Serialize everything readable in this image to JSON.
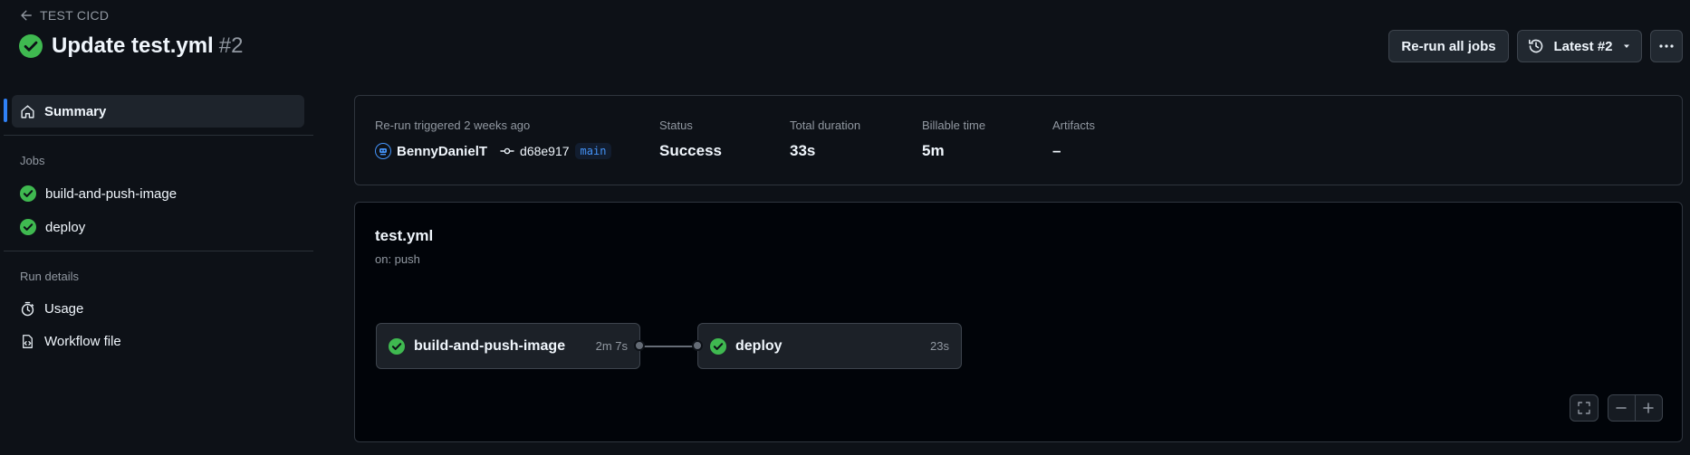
{
  "header": {
    "back_label": "TEST CICD",
    "title": "Update test.yml",
    "run_number": "#2",
    "rerun_label": "Re-run all jobs",
    "latest_label": "Latest #2"
  },
  "sidebar": {
    "summary_label": "Summary",
    "jobs_heading": "Jobs",
    "jobs": [
      {
        "label": "build-and-push-image"
      },
      {
        "label": "deploy"
      }
    ],
    "run_details_heading": "Run details",
    "usage_label": "Usage",
    "workflow_file_label": "Workflow file"
  },
  "summary": {
    "trigger_text": "Re-run triggered 2 weeks ago",
    "actor": "BennyDanielT",
    "commit": "d68e917",
    "branch": "main",
    "status_label": "Status",
    "status_value": "Success",
    "duration_label": "Total duration",
    "duration_value": "33s",
    "billable_label": "Billable time",
    "billable_value": "5m",
    "artifacts_label": "Artifacts",
    "artifacts_value": "–"
  },
  "graph": {
    "workflow_name": "test.yml",
    "trigger": "on: push",
    "jobs": [
      {
        "name": "build-and-push-image",
        "duration": "2m 7s"
      },
      {
        "name": "deploy",
        "duration": "23s"
      }
    ]
  },
  "colors": {
    "success": "#3fb950",
    "accent": "#2f81f7",
    "background": "#0d1117"
  },
  "icons": {
    "back": "arrow-left-icon",
    "status": "check-circle-fill-icon",
    "history": "history-icon",
    "caret": "triangle-down-icon",
    "kebab": "kebab-horizontal-icon",
    "home": "home-icon",
    "stopwatch": "stopwatch-icon",
    "file": "file-code-icon",
    "commit": "git-commit-icon",
    "fullscreen": "screen-full-icon",
    "zoom_out": "dash-icon",
    "zoom_in": "plus-icon"
  }
}
